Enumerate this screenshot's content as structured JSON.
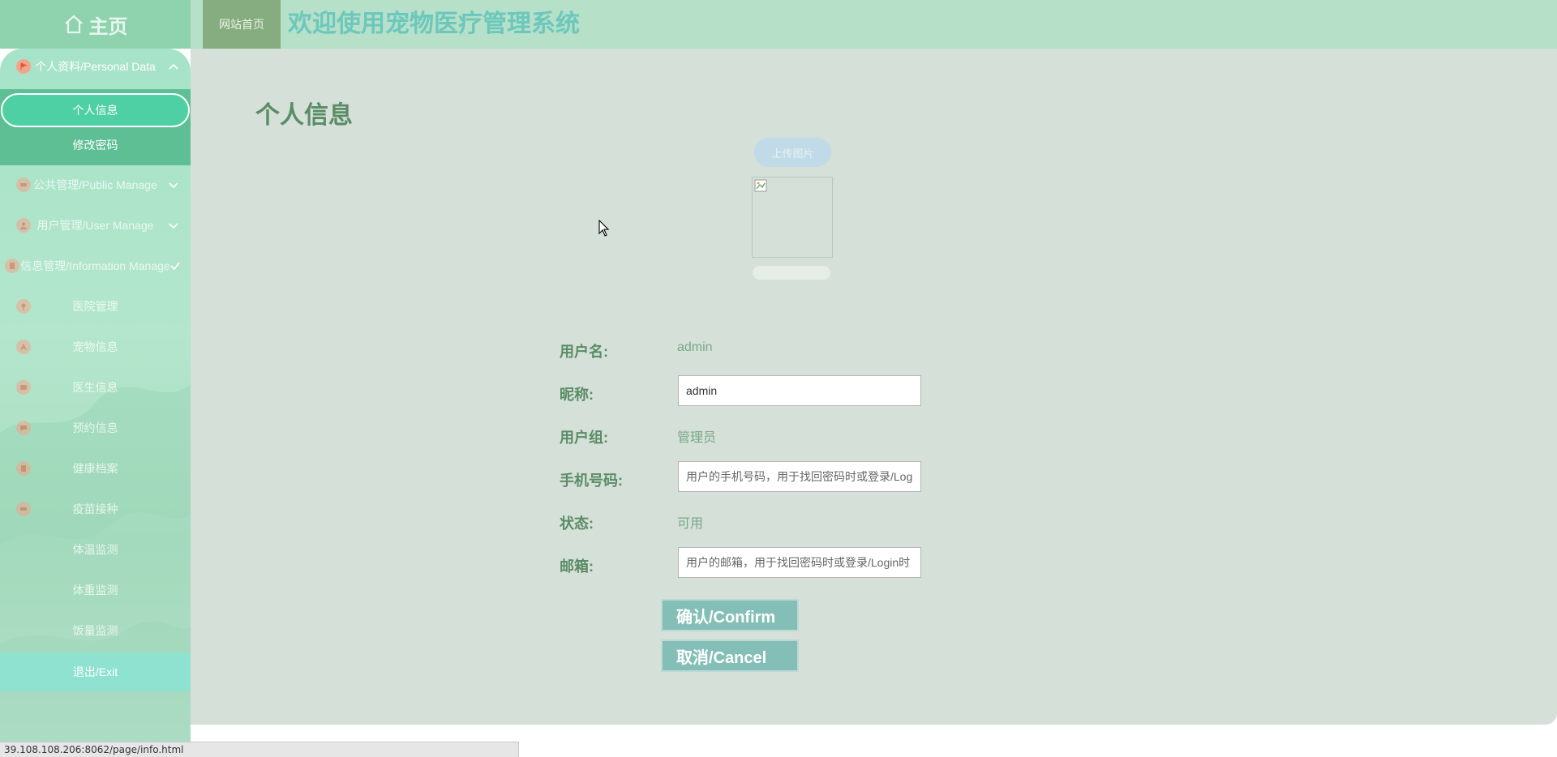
{
  "header": {
    "home_label": "主页",
    "site_home": "网站首页",
    "title": "欢迎使用宠物医疗管理系统"
  },
  "sidebar": {
    "groups": [
      {
        "label": "个人资料/Personal Data",
        "icon": "flag-icon",
        "expanded": true
      },
      {
        "label": "公共管理/Public Manage",
        "icon": "car-icon",
        "expanded": false
      },
      {
        "label": "用户管理/User Manage",
        "icon": "user-icon",
        "expanded": false
      },
      {
        "label": "信息管理/Information Manage",
        "icon": "book-icon",
        "expanded": true
      }
    ],
    "personal_items": [
      "个人信息",
      "修改密码"
    ],
    "info_items": [
      {
        "label": "医院管理",
        "icon": "pin-icon"
      },
      {
        "label": "宠物信息",
        "icon": "navigation-icon"
      },
      {
        "label": "医生信息",
        "icon": "chat-icon"
      },
      {
        "label": "预约信息",
        "icon": "message-icon"
      },
      {
        "label": "健康档案",
        "icon": "document-icon"
      },
      {
        "label": "疫苗接种",
        "icon": "ticket-icon"
      },
      {
        "label": "体温监测",
        "icon": ""
      },
      {
        "label": "体重监测",
        "icon": ""
      },
      {
        "label": "饭量监测",
        "icon": ""
      }
    ],
    "exit": "退出/Exit"
  },
  "main": {
    "title": "个人信息",
    "upload": "上传图片",
    "fields": {
      "username": {
        "label": "用户名:",
        "value": "admin"
      },
      "nickname": {
        "label": "昵称:",
        "value": "admin"
      },
      "usergroup": {
        "label": "用户组:",
        "value": "管理员"
      },
      "phone": {
        "label": "手机号码:",
        "placeholder": "用户的手机号码，用于找回密码时或登录/Login时"
      },
      "status": {
        "label": "状态:",
        "value": "可用"
      },
      "email": {
        "label": "邮箱:",
        "placeholder": "用户的邮箱，用于找回密码时或登录/Login时"
      }
    },
    "confirm": "确认/Confirm",
    "cancel": "取消/Cancel"
  },
  "statusbar": {
    "url": "39.108.108.206:8062/page/info.html"
  },
  "colors": {
    "header_bg": "#b6e0c8",
    "title": "#6cc7bd",
    "main_bg": "#d4e0d8",
    "active_item": "#4fd0a4",
    "button": "#84bfb7",
    "label": "#5a8c66"
  }
}
